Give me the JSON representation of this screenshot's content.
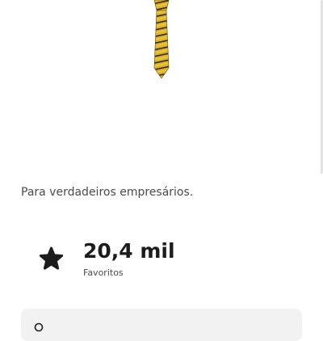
{
  "item": {
    "description": "Para verdadeiros empresários.",
    "favorites": {
      "value": "20,4 mil",
      "label": "Favoritos",
      "icon": "star-icon"
    }
  },
  "colors": {
    "tie_main": "#e0b624",
    "tie_stripe": "#2b2410",
    "card_background": "#f2f2f3",
    "text_primary": "#1c1c1c",
    "text_secondary": "#4a4a4a"
  }
}
